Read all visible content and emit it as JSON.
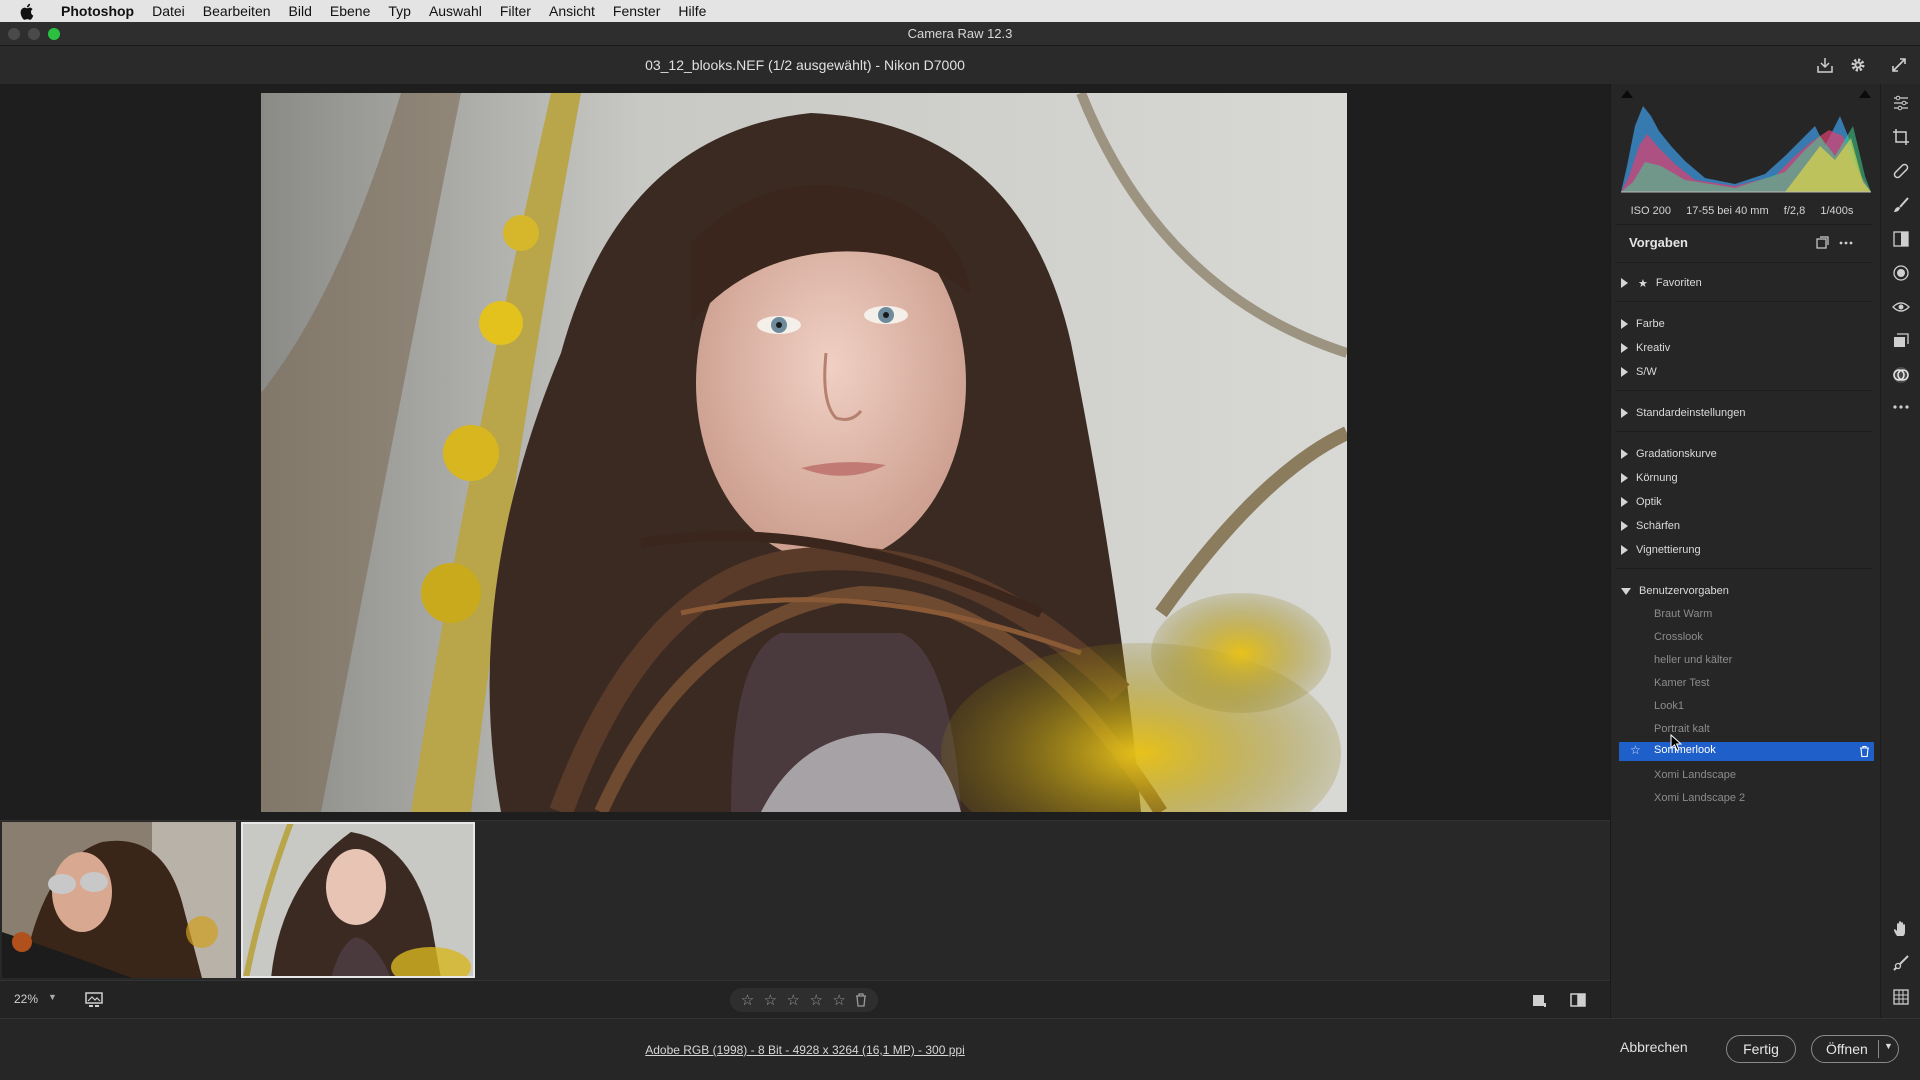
{
  "menubar": {
    "app": "Photoshop",
    "items": [
      "Datei",
      "Bearbeiten",
      "Bild",
      "Ebene",
      "Typ",
      "Auswahl",
      "Filter",
      "Ansicht",
      "Fenster",
      "Hilfe"
    ]
  },
  "window": {
    "title": "Camera Raw 12.3"
  },
  "header": {
    "filename": "03_12_blooks.NEF (1/2 ausgewählt)  -  Nikon D7000"
  },
  "exif": {
    "iso": "ISO 200",
    "lens": "17-55 bei 40 mm",
    "aperture": "f/2,8",
    "shutter": "1/400s"
  },
  "presets": {
    "title": "Vorgaben",
    "favorites": "Favoriten",
    "groups_a": [
      "Farbe",
      "Kreativ",
      "S/W"
    ],
    "standard": "Standardeinstellungen",
    "groups_b": [
      "Gradationskurve",
      "Körnung",
      "Optik",
      "Schärfen",
      "Vignettierung"
    ],
    "user_group": "Benutzervorgaben",
    "user_presets": [
      "Braut Warm",
      "Crosslook",
      "heller und kälter",
      "Kamer Test",
      "Look1",
      "Portrait kalt",
      "Sommerlook",
      "Xomi Landscape",
      "Xomi Landscape 2"
    ],
    "selected": "Sommerlook"
  },
  "toolbar": {
    "zoom": "22%"
  },
  "rating": {
    "stars": 0,
    "max": 5
  },
  "status": {
    "meta": "Adobe RGB (1998) - 8 Bit - 4928 x 3264 (16,1 MP) - 300 ppi"
  },
  "buttons": {
    "cancel": "Abbrechen",
    "done": "Fertig",
    "open": "Öffnen"
  },
  "colors": {
    "accent": "#1f5fc9",
    "traffic_green": "#2bc140"
  },
  "icons": [
    "apple-icon",
    "save-icon",
    "settings-icon",
    "fullscreen-icon",
    "edit-sliders-icon",
    "crop-icon",
    "healing-icon",
    "brush-icon",
    "gradient-icon",
    "radial-icon",
    "redeye-icon",
    "snapshots-icon",
    "presets-icon",
    "more-icon",
    "hand-icon",
    "sampler-icon",
    "grid-icon"
  ]
}
